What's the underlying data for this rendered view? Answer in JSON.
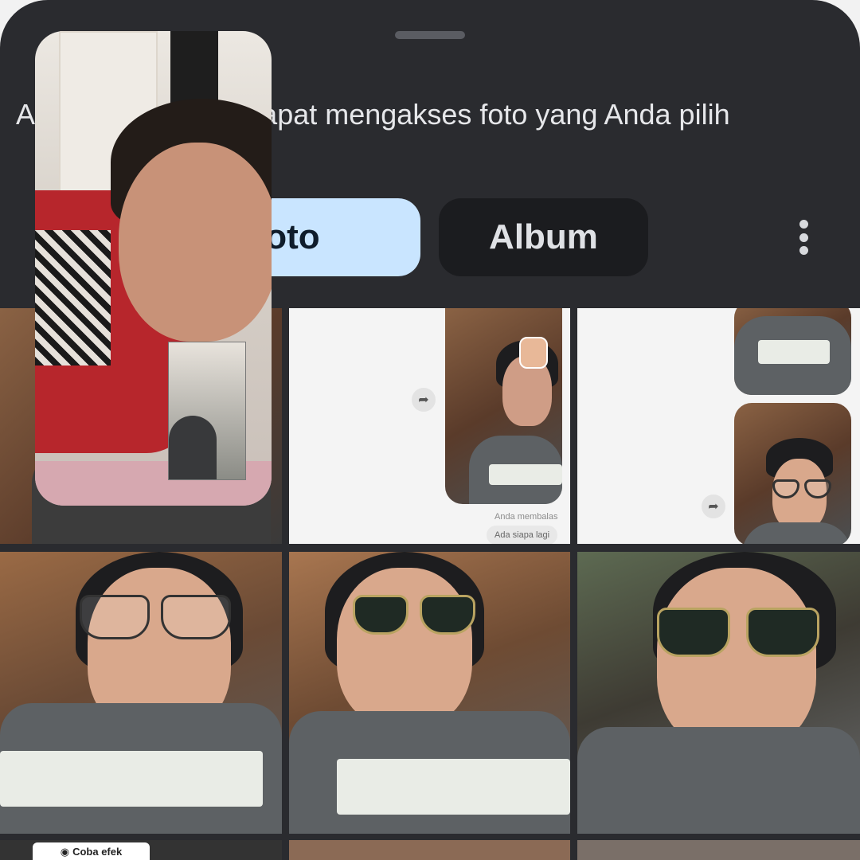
{
  "sheet": {
    "subtitle": "Aplikasi ini hanya dapat mengakses foto yang Anda pilih"
  },
  "tabs": [
    {
      "label": "Foto",
      "selected": true
    },
    {
      "label": "Album",
      "selected": false
    }
  ],
  "more_icon": "more-vertical-icon",
  "grid": {
    "chat_preview": {
      "caption": "Anda membalas",
      "reply": "Ada siapa lagi"
    },
    "effect_label": "Coba efek"
  },
  "colors": {
    "sheet_bg": "#2a2b2f",
    "tab_selected": "#c9e5ff",
    "tab_unselected": "#1b1c1f"
  }
}
